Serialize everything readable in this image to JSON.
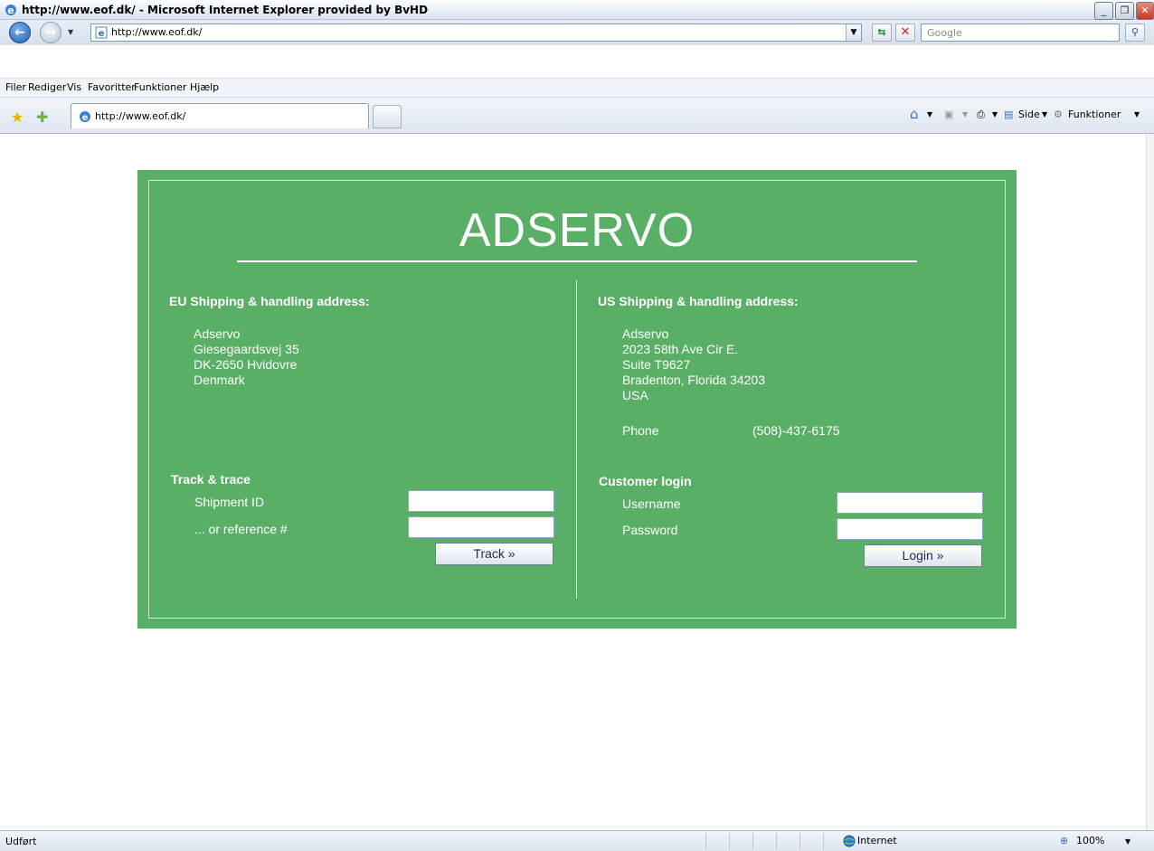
{
  "window": {
    "title": "http://www.eof.dk/ - Microsoft Internet Explorer provided by BvHD",
    "minimize": "_",
    "restore": "❐",
    "close": "✕"
  },
  "navigation": {
    "address": "http://www.eof.dk/",
    "search_placeholder": "Google"
  },
  "menu": [
    "Filer",
    "Rediger",
    "Vis",
    "Favoritter",
    "Funktioner",
    "Hjælp"
  ],
  "tab": {
    "label": "http://www.eof.dk/"
  },
  "commands": {
    "page": "Side",
    "tools": "Funktioner"
  },
  "page": {
    "brand": "ADSERVO",
    "eu": {
      "heading": "EU Shipping & handling address:",
      "lines": [
        "Adservo",
        "Giesegaardsvej 35",
        "DK-2650 Hvidovre",
        "Denmark"
      ]
    },
    "us": {
      "heading": "US Shipping & handling address:",
      "lines": [
        "Adservo",
        "2023 58th Ave Cir E.",
        "Suite T9627",
        "Bradenton, Florida 34203",
        "USA"
      ],
      "phone_label": "Phone",
      "phone_value": "(508)-437-6175"
    },
    "track": {
      "heading": "Track & trace",
      "shipment_label": "Shipment ID",
      "reference_label": "... or reference #",
      "button": "Track »"
    },
    "login": {
      "heading": "Customer login",
      "username_label": "Username",
      "password_label": "Password",
      "button": "Login »"
    }
  },
  "status": {
    "text": "Udført",
    "zone": "Internet",
    "zoom": "100%"
  },
  "colors": {
    "panel": "#5aaf66",
    "text": "#ffffff"
  }
}
